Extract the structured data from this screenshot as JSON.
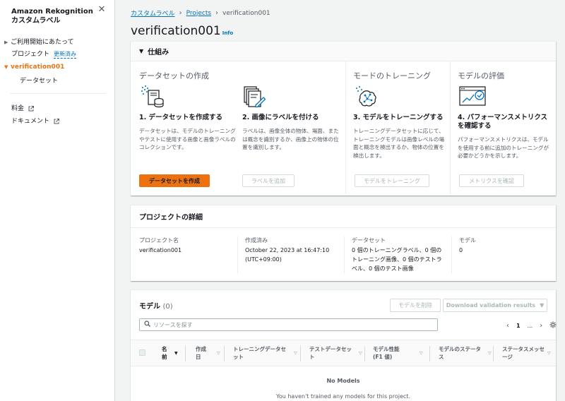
{
  "sidebar": {
    "service": "Amazon Rekognition",
    "feature": "カスタムラベル",
    "items": [
      {
        "label": "ご利用開始にあたって"
      },
      {
        "label": "プロジェクト",
        "badge": "更新済み"
      },
      {
        "label": "verification001"
      },
      {
        "label": "データセット"
      },
      {
        "label": "料金"
      },
      {
        "label": "ドキュメント"
      }
    ]
  },
  "breadcrumb": [
    "カスタムラベル",
    "Projects",
    "verification001"
  ],
  "page": {
    "title": "verification001",
    "info": "Info"
  },
  "workflow": {
    "header": "仕組み",
    "stages": [
      "データセットの作成",
      "モードのトレーニング",
      "モデルの評価"
    ],
    "steps": [
      {
        "title": "1. データセットを作成する",
        "desc": "データセットは、モデルのトレーニングやテストに使用する画像と画像ラベルのコレクションです。",
        "button": "データセットを作成"
      },
      {
        "title": "2. 画像にラベルを付ける",
        "desc": "ラベルは、画像全体の物体、場面、または概念を識別するか、画像上の物体の位置を識別します。",
        "button": "ラベルを追加"
      },
      {
        "title": "3. モデルをトレーニングする",
        "desc": "トレーニングデータセットに応じて、トレーニングモデルは画像レベルの場面と概念を検出するか、物体の位置を検出します。",
        "button": "モデルをトレーニング"
      },
      {
        "title": "4. パフォーマンスメトリクスを確認する",
        "desc": "パフォーマンスメトリクスは、モデルを使用する前に追加のトレーニングが必要かどうかを示します。",
        "button": "メトリクスを確認"
      }
    ]
  },
  "details": {
    "header": "プロジェクトの詳細",
    "fields": [
      {
        "label": "プロジェクト名",
        "value": "verification001"
      },
      {
        "label": "作成済み",
        "value": "October 22, 2023 at 16:47:10 (UTC+09:00)"
      },
      {
        "label": "データセット",
        "value": "0 個のトレーニングラベル、0 個のトレーニング画像、0 個のテストラベル、0 個のテスト画像"
      },
      {
        "label": "モデル",
        "value": "0"
      }
    ]
  },
  "models": {
    "title": "モデル",
    "count": "(0)",
    "delete_button": "モデルを削除",
    "download_button": "Download validation results",
    "search_placeholder": "リソースを探す",
    "page": "1",
    "ellipsis": "...",
    "columns": [
      "名前",
      "作成日",
      "トレーニングデータセット",
      "テストデータセット",
      "モデル性能 (F1 値)",
      "モデルのステータス",
      "ステータスメッセージ"
    ],
    "empty_title": "No Models",
    "empty_desc": "You haven't trained any models for this project."
  }
}
